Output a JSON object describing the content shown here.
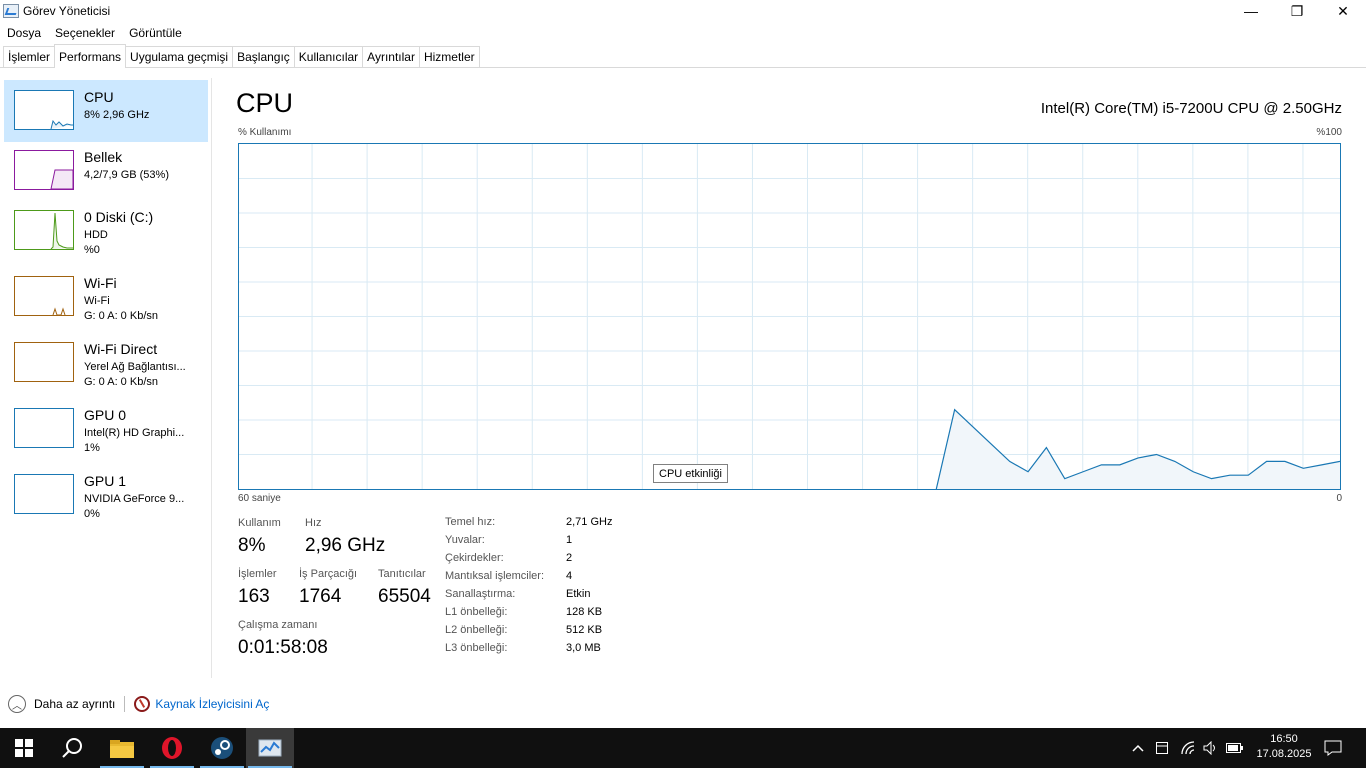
{
  "window": {
    "title": "Görev Yöneticisi",
    "minimize": "—",
    "restore": "❐",
    "close": "✕"
  },
  "menu": [
    "Dosya",
    "Seçenekler",
    "Görüntüle"
  ],
  "tabs": [
    "İşlemler",
    "Performans",
    "Uygulama geçmişi",
    "Başlangıç",
    "Kullanıcılar",
    "Ayrıntılar",
    "Hizmetler"
  ],
  "sidebar": {
    "items": [
      {
        "title": "CPU",
        "line1": "8% 2,96 GHz",
        "line2": "",
        "color": "#1a78b4"
      },
      {
        "title": "Bellek",
        "line1": "4,2/7,9 GB (53%)",
        "line2": "",
        "color": "#8b1a9e"
      },
      {
        "title": "0 Diski (C:)",
        "line1": "HDD",
        "line2": "%0",
        "color": "#4d9a1a"
      },
      {
        "title": "Wi-Fi",
        "line1": "Wi-Fi",
        "line2": "G: 0 A: 0 Kb/sn",
        "color": "#a0620f"
      },
      {
        "title": "Wi-Fi Direct",
        "line1": "Yerel Ağ Bağlantısı...",
        "line2": "G: 0 A: 0 Kb/sn",
        "color": "#a0620f"
      },
      {
        "title": "GPU 0",
        "line1": "Intel(R) HD Graphi...",
        "line2": "1%",
        "color": "#1a78b4"
      },
      {
        "title": "GPU 1",
        "line1": "NVIDIA GeForce 9...",
        "line2": "0%",
        "color": "#1a78b4"
      }
    ]
  },
  "main": {
    "title": "CPU",
    "model": "Intel(R) Core(TM) i5-7200U CPU @ 2.50GHz",
    "graph_top_left": "% Kullanımı",
    "graph_top_right": "%100",
    "graph_bottom_left": "60 saniye",
    "graph_bottom_right": "0",
    "tooltip": "CPU etkinliği",
    "stats": {
      "usage_label": "Kullanım",
      "usage_value": "8%",
      "speed_label": "Hız",
      "speed_value": "2,96 GHz",
      "processes_label": "İşlemler",
      "processes_value": "163",
      "threads_label": "İş Parçacığı",
      "threads_value": "1764",
      "handles_label": "Tanıtıcılar",
      "handles_value": "65504",
      "uptime_label": "Çalışma zamanı",
      "uptime_value": "0:01:58:08"
    },
    "specs": [
      {
        "key": "Temel hız:",
        "value": "2,71 GHz"
      },
      {
        "key": "Yuvalar:",
        "value": "1"
      },
      {
        "key": "Çekirdekler:",
        "value": "2"
      },
      {
        "key": "Mantıksal işlemciler:",
        "value": "4"
      },
      {
        "key": "Sanallaştırma:",
        "value": "Etkin"
      },
      {
        "key": "L1 önbelleği:",
        "value": "128 KB"
      },
      {
        "key": "L2 önbelleği:",
        "value": "512 KB"
      },
      {
        "key": "L3 önbelleği:",
        "value": "3,0 MB"
      }
    ]
  },
  "chart_data": {
    "type": "area",
    "title": "",
    "xlabel": "",
    "ylabel": "% Kullanımı",
    "xlim": [
      0,
      60
    ],
    "ylim": [
      0,
      100
    ],
    "x_unit": "seconds",
    "series": [
      {
        "x": [
          0,
          1,
          2,
          3,
          4,
          5,
          6,
          7,
          8,
          9,
          10,
          11,
          12,
          13,
          14,
          15,
          16,
          17,
          18,
          19,
          20,
          21,
          22
        ],
        "values": [
          0,
          23,
          18,
          13,
          8,
          5,
          12,
          3,
          5,
          7,
          7,
          9,
          10,
          8,
          5,
          3,
          4,
          4,
          8,
          8,
          6,
          7,
          8
        ]
      }
    ],
    "color": "#1a78b4",
    "fill": "#f1f6fa",
    "grid": true
  },
  "footer": {
    "less_details": "Daha az ayrıntı",
    "resource_monitor": "Kaynak İzleyicisini Aç"
  },
  "taskbar": {
    "time": "16:50",
    "date": "17.08.2025"
  }
}
